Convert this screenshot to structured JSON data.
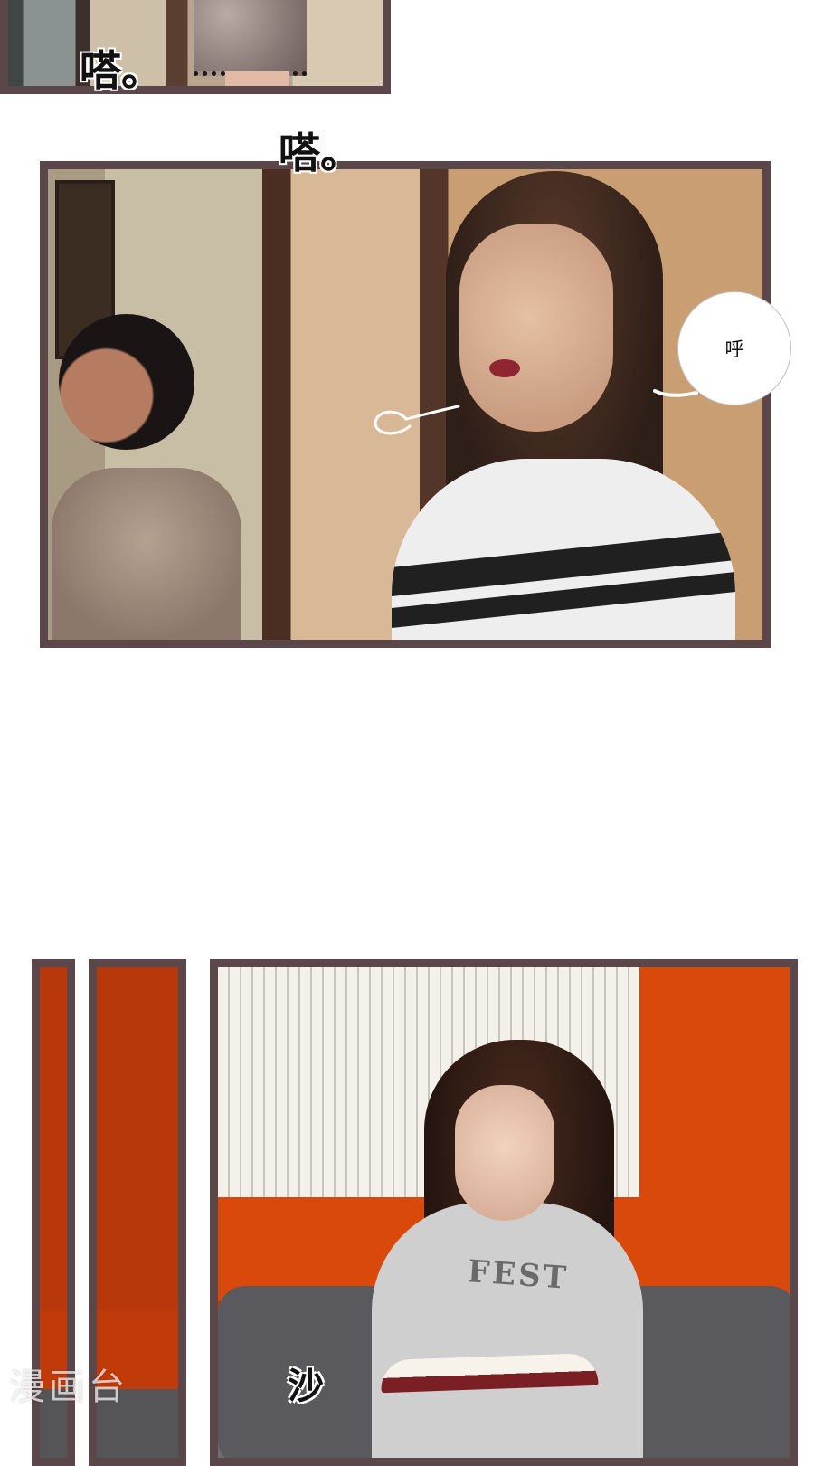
{
  "sfx": {
    "knock_top": "嗒。",
    "knock_middle": "嗒。",
    "rustle": "沙"
  },
  "bubble": {
    "text": "呼"
  },
  "panel3": {
    "shirt_text": "FEST"
  },
  "watermark": "漫画台",
  "colors": {
    "panel_border": "#5b4649",
    "wall_orange": "#d9490b"
  }
}
